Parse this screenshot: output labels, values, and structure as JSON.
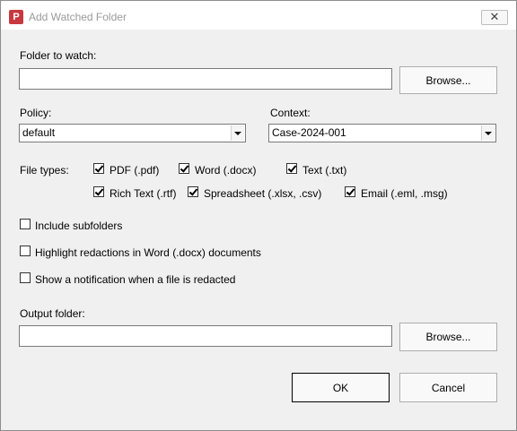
{
  "window": {
    "title": "Add Watched Folder",
    "app_icon_letter": "P",
    "close_glyph": "✕"
  },
  "folder": {
    "label": "Folder to watch:",
    "value": "",
    "browse_label": "Browse..."
  },
  "policy": {
    "label": "Policy:",
    "selected": "default"
  },
  "context": {
    "label": "Context:",
    "selected": "Case-2024-001"
  },
  "file_types": {
    "label": "File types:",
    "items": [
      {
        "label": "PDF (.pdf)",
        "checked": true
      },
      {
        "label": "Word (.docx)",
        "checked": true
      },
      {
        "label": "Text (.txt)",
        "checked": true
      },
      {
        "label": "Rich Text (.rtf)",
        "checked": true
      },
      {
        "label": "Spreadsheet (.xlsx, .csv)",
        "checked": true
      },
      {
        "label": "Email (.eml, .msg)",
        "checked": true
      }
    ]
  },
  "options": [
    {
      "label": "Include subfolders",
      "checked": false
    },
    {
      "label": "Highlight redactions in Word (.docx) documents",
      "checked": false
    },
    {
      "label": "Show a notification when a file is redacted",
      "checked": false
    }
  ],
  "output": {
    "label": "Output folder:",
    "value": "",
    "browse_label": "Browse..."
  },
  "buttons": {
    "ok": "OK",
    "cancel": "Cancel"
  },
  "colors": {
    "app_icon": "#c8383f",
    "dialog_bg": "#f0f0f0"
  }
}
